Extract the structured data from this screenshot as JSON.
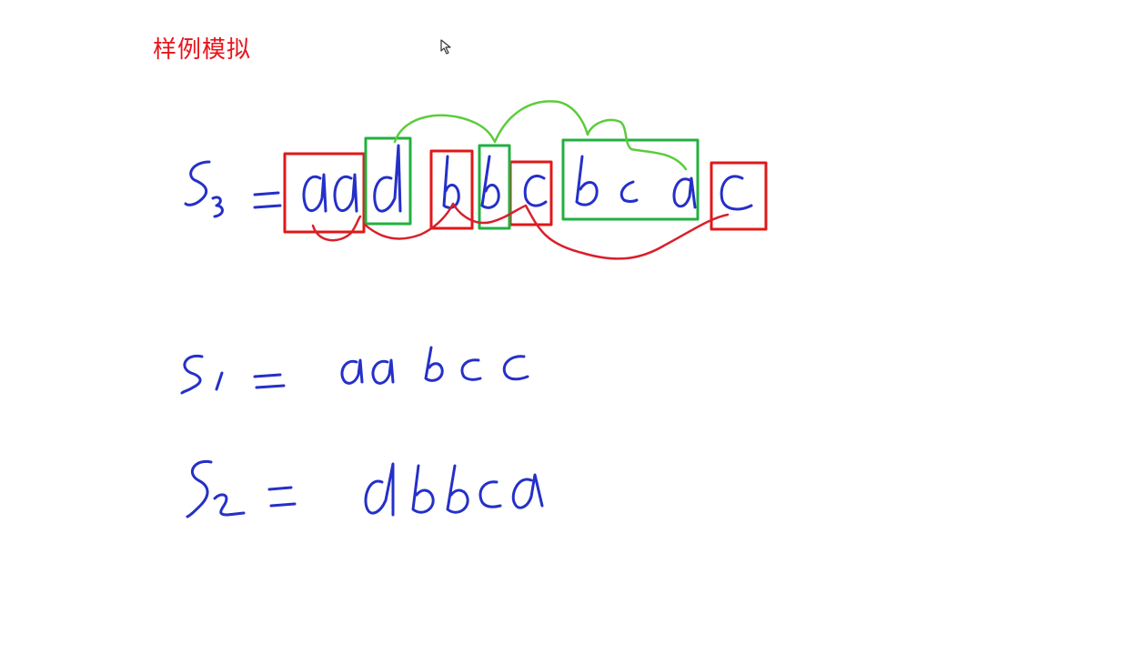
{
  "heading": "样例模拟",
  "colors": {
    "heading": "#e8141c",
    "ink": "#2530c8",
    "red_box": "#e01818",
    "green_box": "#22b040",
    "red_arc": "#d8202c",
    "green_arc": "#5ccc3c"
  },
  "icons": {
    "cursor": "mouse-pointer-icon"
  }
}
